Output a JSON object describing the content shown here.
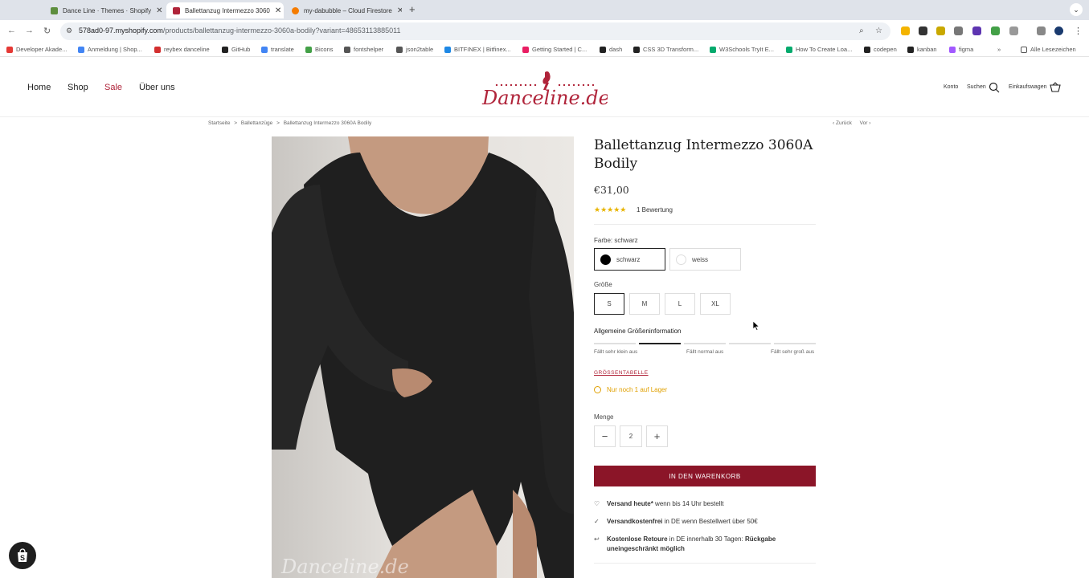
{
  "browser": {
    "tabs": [
      {
        "label": "Dance Line · Themes · Shopify",
        "color": "#5e8e3e"
      },
      {
        "label": "Ballettanzug Intermezzo 3060",
        "color": "#b0243a"
      },
      {
        "label": "my-dabubble – Cloud Firestore",
        "color": "#f57c00"
      }
    ],
    "new_tab": "+",
    "url_host": "578ad0-97.myshopify.com",
    "url_path": "/products/ballettanzug-intermezzo-3060a-bodily?variant=48653113885011",
    "bookmarks": [
      {
        "label": "Developer Akade...",
        "color": "#e53935"
      },
      {
        "label": "Anmeldung | Shop...",
        "color": "#4285f4"
      },
      {
        "label": "reybex danceline",
        "color": "#d32f2f"
      },
      {
        "label": "GitHub",
        "color": "#222222"
      },
      {
        "label": "translate",
        "color": "#4285f4"
      },
      {
        "label": "Bicons",
        "color": "#43a047"
      },
      {
        "label": "fontshelper",
        "color": "#555555"
      },
      {
        "label": "json2table",
        "color": "#555555"
      },
      {
        "label": "BITFINEX | Bitfinex...",
        "color": "#1e88e5"
      },
      {
        "label": "Getting Started | C...",
        "color": "#e91e63"
      },
      {
        "label": "dash",
        "color": "#222222"
      },
      {
        "label": "CSS 3D Transform...",
        "color": "#222222"
      },
      {
        "label": "W3Schools TryIt E...",
        "color": "#04aa6d"
      },
      {
        "label": "How To Create Loa...",
        "color": "#04aa6d"
      },
      {
        "label": "codepen",
        "color": "#222222"
      },
      {
        "label": "kanban",
        "color": "#222222"
      },
      {
        "label": "figma",
        "color": "#a259ff"
      }
    ],
    "more_bookmarks": "»",
    "reading_list": "Alle Lesezeichen"
  },
  "header": {
    "nav": [
      "Home",
      "Shop",
      "Sale",
      "Über uns"
    ],
    "logo_text": "Danceline.de",
    "account": "Konto",
    "search": "Suchen",
    "cart": "Einkaufswagen"
  },
  "breadcrumb": {
    "items": [
      "Startseite",
      "Ballettanzüge",
      "Ballettanzug Intermezzo 3060A Bodily"
    ],
    "sep": ">"
  },
  "pager": {
    "prev": "Zurück",
    "next": "Vor"
  },
  "product": {
    "title": "Ballettanzug Intermezzo 3060A Bodily",
    "price": "€31,00",
    "stars": "★★★★★",
    "reviews": "1 Bewertung",
    "color_label": "Farbe: schwarz",
    "colors": [
      {
        "label": "schwarz",
        "swatch": "#000000"
      },
      {
        "label": "weiss",
        "swatch": "#ffffff"
      }
    ],
    "size_label": "Größe",
    "sizes": [
      "S",
      "M",
      "L",
      "XL"
    ],
    "size_info_title": "Allgemeine Größeninformation",
    "fit_labels": [
      "Fällt sehr klein aus",
      "Fällt normal aus",
      "Fällt sehr groß aus"
    ],
    "fit_level": 0.25,
    "size_table": "GRÖSSENTABELLE",
    "stock": "Nur noch 1 auf Lager",
    "qty_label": "Menge",
    "qty": "2",
    "add_to_cart": "IN DEN WARENKORB",
    "perks": [
      {
        "bold": "Versand heute*",
        "rest": " wenn bis 14 Uhr bestellt",
        "icon": "heart-icon"
      },
      {
        "bold": "Versandkostenfrei",
        "rest": " in DE wenn Bestellwert über 50€",
        "icon": "check-icon"
      },
      {
        "bold": "Kostenlose Retoure",
        "rest": " in DE innerhalb 30 Tagen: ",
        "bold2": "Rückgabe uneingeschränkt möglich",
        "icon": "return-icon"
      }
    ],
    "image_watermark": "Danceline.de"
  },
  "colors": {
    "brand": "#8b1528",
    "sale": "#b0243a",
    "stars": "#e8b400",
    "stock": "#e0a000"
  }
}
